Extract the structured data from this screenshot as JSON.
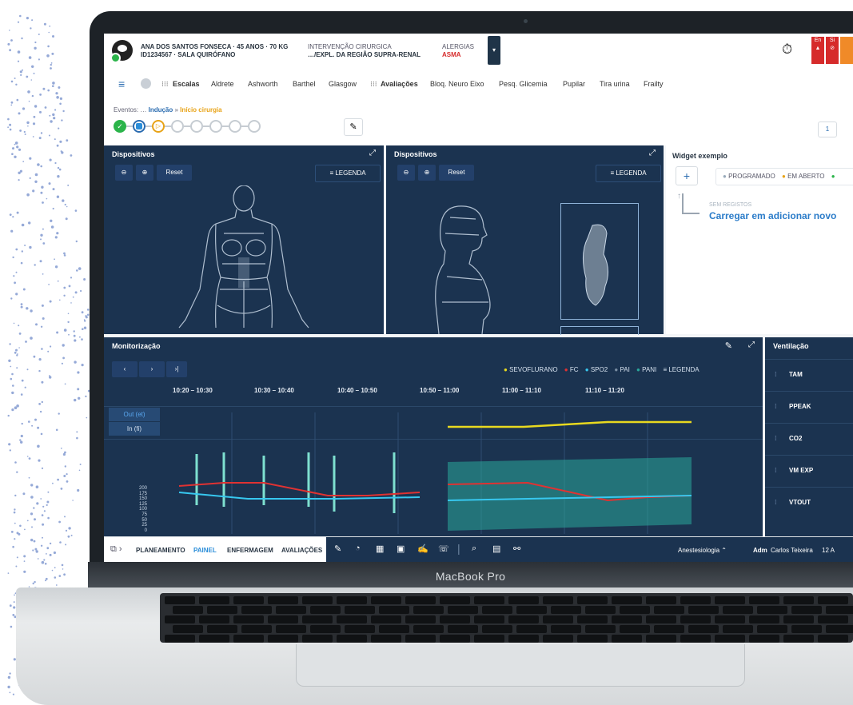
{
  "patient": {
    "line1": "ANA DOS SANTOS FONSECA · 45 ANOS · 70 KG",
    "line2": "ID1234567 · SALA QUIRÓFANO",
    "procedure_label": "INTERVENÇÃO CIRURGICA",
    "procedure_value": "…/EXPL. DA REGIÃO SUPRA-RENAL",
    "allergy_label": "ALERGIAS",
    "allergy_value": "ASMA"
  },
  "header_alerts": [
    {
      "label": "En"
    },
    {
      "label": "Si"
    }
  ],
  "nav": {
    "items": [
      "Escalas",
      "Aldrete",
      "Ashworth",
      "Barthel",
      "Glasgow",
      "Avaliações",
      "Bloq. Neuro Eixo",
      "Pesq. Glicemia",
      "Pupilar",
      "Tira urina",
      "Frailty"
    ]
  },
  "events": {
    "label": "Eventos: …",
    "crumb1": "Indução",
    "crumb_sep": " » ",
    "crumb2": "Início cirurgia",
    "page": "1"
  },
  "dispositivos_left": {
    "title": "Dispositivos",
    "reset": "Reset",
    "legend": "≡ LEGENDA"
  },
  "dispositivos_right": {
    "title": "Dispositivos",
    "reset": "Reset",
    "legend": "≡ LEGENDA"
  },
  "widget": {
    "title": "Widget exemplo",
    "add": "+",
    "status1": "PROGRAMADO",
    "status2": "EM ABERTO",
    "empty_label": "SEM REGISTOS",
    "empty_action": "Carregar em adicionar novo"
  },
  "monitorizacao": {
    "title": "Monitorização",
    "nav": [
      "‹",
      "›",
      "›|"
    ],
    "legend": [
      "SEVOFLURANO",
      "FC",
      "SPO2",
      "PAI",
      "PANI",
      "≡ LEGENDA"
    ],
    "times": [
      "10:20 – 10:30",
      "10:30 – 10:40",
      "10:40 – 10:50",
      "10:50 – 11:00",
      "11:00 – 11:10",
      "11:10 – 11:20"
    ],
    "rows": [
      "Out (et)",
      "In (fi)"
    ],
    "y_ticks": [
      "200",
      "175",
      "150",
      "125",
      "100",
      "75",
      "50",
      "25",
      "0"
    ],
    "colors": {
      "sevo": "#e8d91f",
      "fc": "#e03232",
      "spo2": "#37c8f0",
      "band": "#2aa79b"
    }
  },
  "ventilacao": {
    "title": "Ventilação",
    "rows": [
      "TAM",
      "PPEAK",
      "CO2",
      "VM EXP",
      "VTOUT"
    ]
  },
  "footer": {
    "tabs": [
      "PLANEAMENTO",
      "PAINEL",
      "ENFERMAGEM",
      "AVALIAÇÕES"
    ],
    "specialty": "Anestesiologia ⌃",
    "user_role": "Adm",
    "user_name": "Carlos Teixeira",
    "extra": "12 A"
  },
  "laptop": {
    "model": "MacBook Pro"
  }
}
